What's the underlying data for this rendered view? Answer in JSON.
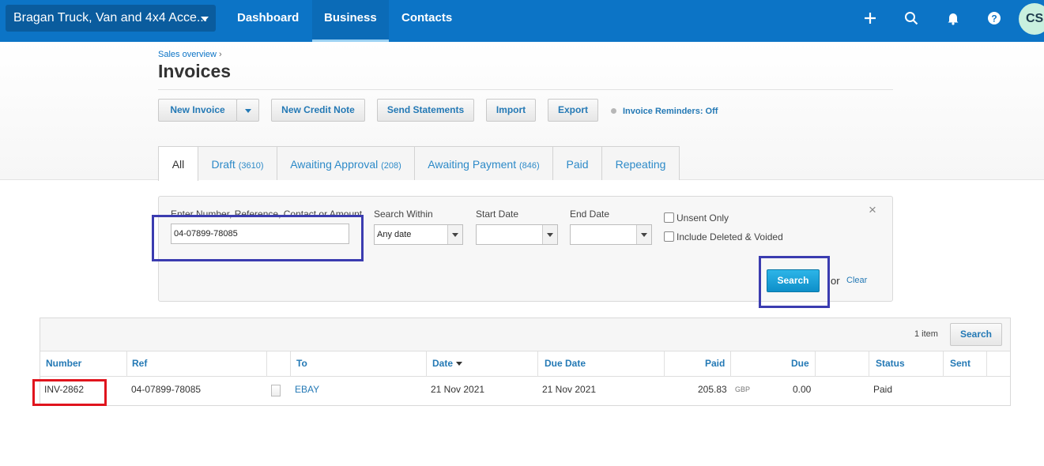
{
  "topbar": {
    "org_name": "Bragan Truck, Van and 4x4 Acce...",
    "nav": [
      "Dashboard",
      "Business",
      "Contacts"
    ],
    "active_nav": "Business",
    "icons": [
      "plus-icon",
      "search-icon",
      "bell-icon",
      "help-icon"
    ],
    "avatar_initials": "CS"
  },
  "header": {
    "breadcrumb": "Sales overview",
    "breadcrumb_sep": "›",
    "title": "Invoices"
  },
  "toolbar": {
    "new_invoice": "New Invoice",
    "new_credit_note": "New Credit Note",
    "send_statements": "Send Statements",
    "import": "Import",
    "export": "Export",
    "reminders": "Invoice Reminders: Off"
  },
  "tabs": [
    {
      "label": "All",
      "count": ""
    },
    {
      "label": "Draft",
      "count": "(3610)"
    },
    {
      "label": "Awaiting Approval",
      "count": "(208)"
    },
    {
      "label": "Awaiting Payment",
      "count": "(846)"
    },
    {
      "label": "Paid",
      "count": ""
    },
    {
      "label": "Repeating",
      "count": ""
    }
  ],
  "search_panel": {
    "query_label": "Enter Number, Reference, Contact or Amount",
    "query_value": "04-07899-78085",
    "within_label": "Search Within",
    "within_value": "Any date",
    "start_label": "Start Date",
    "start_value": "",
    "end_label": "End Date",
    "end_value": "",
    "unsent_only": "Unsent Only",
    "include_deleted": "Include Deleted & Voided",
    "search_button": "Search",
    "or_text": "or",
    "clear": "Clear",
    "close": "×"
  },
  "results": {
    "count": "1 item",
    "search_button": "Search",
    "columns": [
      "Number",
      "Ref",
      "To",
      "Date",
      "Due Date",
      "Paid",
      "Due",
      "Status",
      "Sent"
    ],
    "rows": [
      {
        "number": "INV-2862",
        "ref": "04-07899-78085",
        "to": "EBAY",
        "date": "21 Nov 2021",
        "due_date": "21 Nov 2021",
        "paid": "205.83",
        "currency": "GBP",
        "due": "0.00",
        "status": "Paid",
        "sent": ""
      }
    ]
  },
  "colors": {
    "topbar": "#0c74c6",
    "link": "#2479b5",
    "highlight_blue": "#3b3cb0",
    "highlight_red": "#e0141d"
  }
}
